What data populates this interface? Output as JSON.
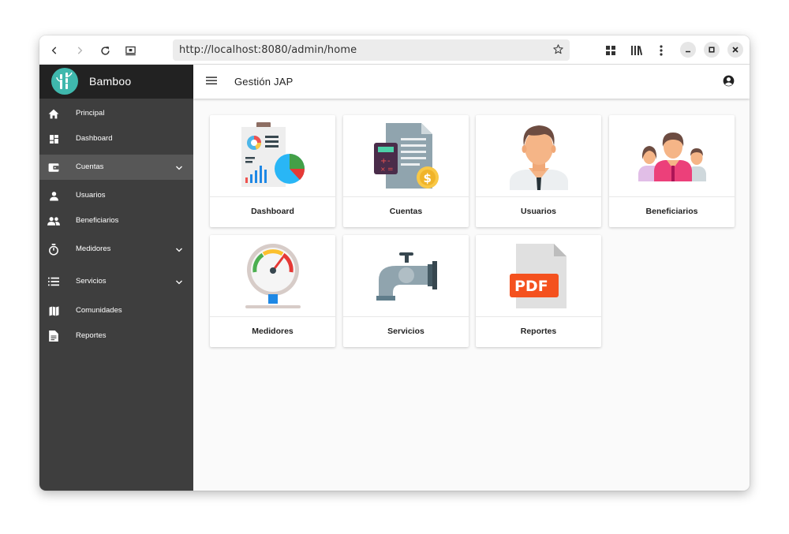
{
  "browser": {
    "url": "http://localhost:8080/admin/home"
  },
  "sidebar": {
    "brand": "Bamboo",
    "items": [
      {
        "label": "Principal",
        "icon": "home-icon"
      },
      {
        "label": "Dashboard",
        "icon": "dashboard-icon"
      },
      {
        "label": "Cuentas",
        "icon": "wallet-icon",
        "expandable": true,
        "active": true
      },
      {
        "label": "Usuarios",
        "icon": "person-icon"
      },
      {
        "label": "Beneficiarios",
        "icon": "people-icon"
      },
      {
        "label": "Medidores",
        "icon": "timer-icon",
        "expandable": true
      },
      {
        "label": "Servicios",
        "icon": "list-icon",
        "expandable": true
      },
      {
        "label": "Comunidades",
        "icon": "map-icon"
      },
      {
        "label": "Reportes",
        "icon": "document-icon"
      }
    ]
  },
  "appbar": {
    "title": "Gestión JAP"
  },
  "cards": [
    {
      "label": "Dashboard",
      "icon": "dashboard-chart-illustration"
    },
    {
      "label": "Cuentas",
      "icon": "invoice-calculator-illustration"
    },
    {
      "label": "Usuarios",
      "icon": "user-avatar-illustration"
    },
    {
      "label": "Beneficiarios",
      "icon": "family-illustration"
    },
    {
      "label": "Medidores",
      "icon": "pressure-gauge-illustration"
    },
    {
      "label": "Servicios",
      "icon": "water-faucet-illustration"
    },
    {
      "label": "Reportes",
      "icon": "pdf-file-illustration"
    }
  ],
  "colors": {
    "sidebar": "#3e3e3e",
    "sidebar_header": "#222222",
    "sidebar_active": "#575757",
    "brand_accent": "#3fb8ad",
    "content_bg": "#fafafa"
  }
}
